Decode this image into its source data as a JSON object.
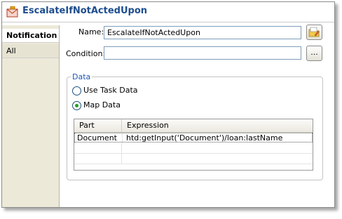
{
  "title": "EscalateIfNotActedUpon",
  "sidebar": {
    "items": [
      {
        "label": "Notification"
      },
      {
        "label": "All"
      }
    ]
  },
  "form": {
    "name_label": "Name:",
    "name_value": "EscalateIfNotActedUpon",
    "condition_label": "Condition:",
    "condition_value": "",
    "condition_button": "..."
  },
  "data_group": {
    "legend": "Data",
    "options": [
      {
        "label": "Use Task Data",
        "checked": false
      },
      {
        "label": "Map Data",
        "checked": true
      }
    ],
    "table": {
      "columns": [
        "Part",
        "Expression"
      ],
      "rows": [
        {
          "part": "Document",
          "expression": "htd:getInput('Document')/loan:lastName"
        }
      ]
    }
  },
  "colors": {
    "title": "#1d4e8f",
    "legend": "#1f57b3",
    "sidebar": "#ece9d8",
    "radio_dot": "#21a121"
  },
  "icons": {
    "title": "envelope-escalation-icon",
    "name_button": "folder-pencil-icon"
  }
}
